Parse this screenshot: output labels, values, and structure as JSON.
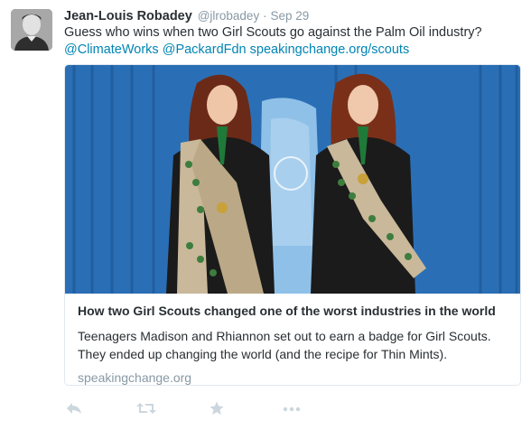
{
  "author": {
    "name": "Jean-Louis Robadey",
    "handle": "@jlrobadey",
    "separator": "·",
    "timestamp": "Sep 29"
  },
  "tweet": {
    "text": "Guess who wins when two Girl Scouts go against the Palm Oil industry?",
    "mention_1": "@ClimateWorks",
    "mention_2": "@PackardFdn",
    "link": "speakingchange.org/scouts"
  },
  "card": {
    "title": "How two Girl Scouts changed one of the worst industries in the world",
    "description": "Teenagers Madison and Rhiannon set out to earn a badge for Girl Scouts. They ended up changing the world (and the recipe for Thin Mints).",
    "domain": "speakingchange.org"
  },
  "actions": {
    "reply_icon": "reply-icon",
    "retweet_icon": "retweet-icon",
    "favorite_icon": "star-icon",
    "more_icon": "more-icon"
  },
  "colors": {
    "link": "#0084b4",
    "muted": "#8899a6",
    "text": "#292f33",
    "border": "#e1e8ed",
    "action": "#ccd6dd"
  }
}
